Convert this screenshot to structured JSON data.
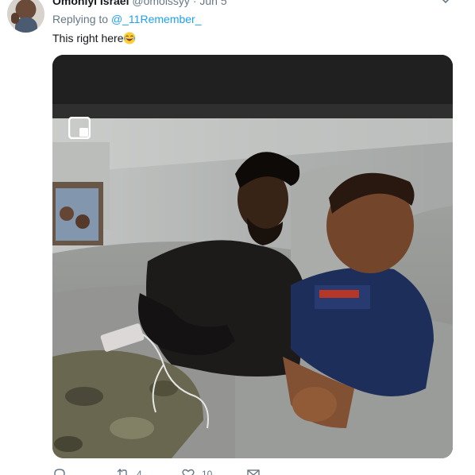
{
  "tweet": {
    "display_name": "Omoniyi Israel",
    "handle_and_date": "@omoissyy · Jun 5",
    "replying_prefix": "Replying to",
    "replying_to": "@_11Remember_",
    "text": "This right here",
    "emoji": "face-with-tears-of-joy",
    "actions": {
      "reply_count": "",
      "retweet_count": "4",
      "like_count": "10"
    }
  },
  "icons": {
    "caret": "chevron-down-icon",
    "reply": "reply-icon",
    "retweet": "retweet-icon",
    "like": "heart-icon",
    "share": "share-icon",
    "pip": "picture-in-picture-icon"
  },
  "colors": {
    "link": "#1da1f2",
    "muted": "#657786",
    "text": "#14171a"
  }
}
